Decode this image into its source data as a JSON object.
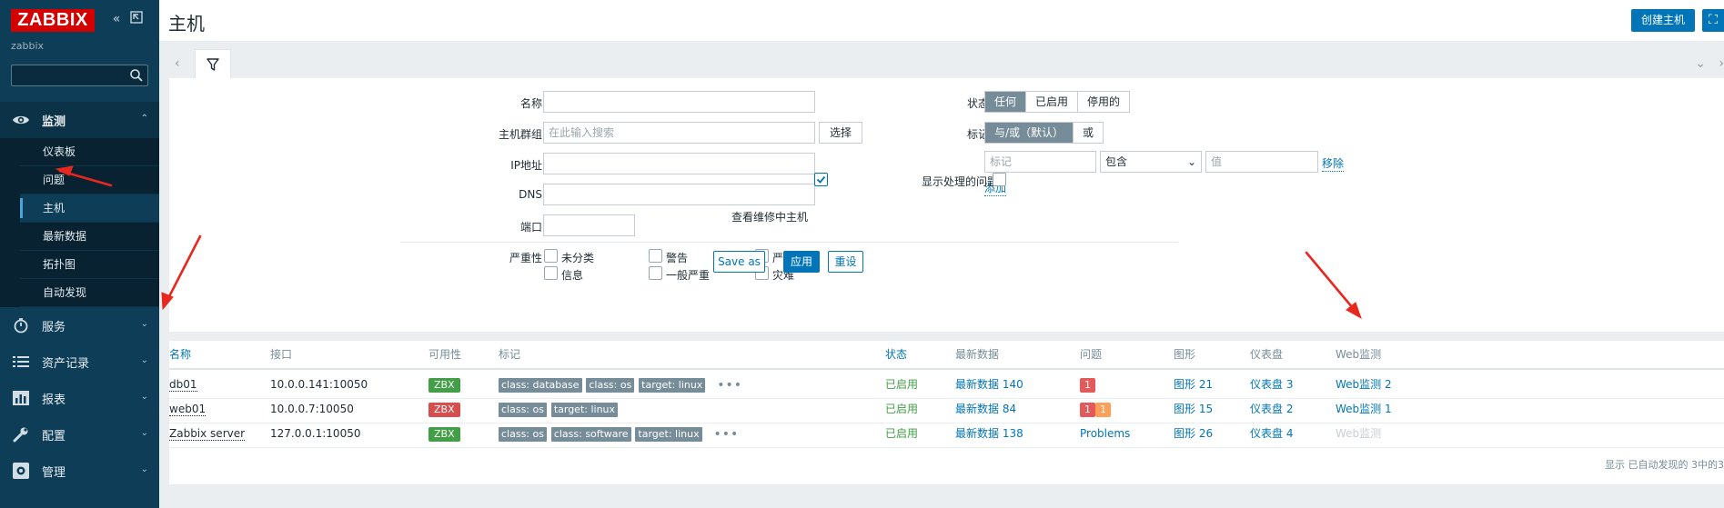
{
  "sidebar": {
    "logo": "ZABBIX",
    "server_name": "zabbix",
    "search_placeholder": "",
    "sections": [
      {
        "label": "监测",
        "icon": "eye-icon",
        "open": true
      },
      {
        "label": "服务",
        "icon": "clock-icon"
      },
      {
        "label": "资产记录",
        "icon": "list-icon"
      },
      {
        "label": "报表",
        "icon": "chart-icon"
      },
      {
        "label": "配置",
        "icon": "wrench-icon"
      },
      {
        "label": "管理",
        "icon": "gear-icon"
      }
    ],
    "monitoring_items": [
      "仪表板",
      "问题",
      "主机",
      "最新数据",
      "拓扑图",
      "自动发现"
    ],
    "selected_item": "主机"
  },
  "header": {
    "title": "主机",
    "create_button": "创建主机"
  },
  "filter": {
    "labels": {
      "name": "名称",
      "host_groups": "主机群组",
      "ip": "IP地址",
      "dns": "DNS",
      "port": "端口",
      "severity": "严重性",
      "status": "状态",
      "tags": "标记",
      "show_maintenance": "查看维修中主机",
      "show_suppressed": "显示处理的问题"
    },
    "host_groups_placeholder": "在此输入搜索",
    "select_button": "选择",
    "status_options": [
      "任何",
      "已启用",
      "停用的"
    ],
    "status_selected": "任何",
    "tag_eval_options": [
      "与/或（默认）",
      "或"
    ],
    "tag_eval_selected": "与/或（默认）",
    "tag_placeholder": "标记",
    "tag_operator": "包含",
    "tag_value_placeholder": "值",
    "remove_link": "移除",
    "add_link": "添加",
    "severities": [
      "未分类",
      "警告",
      "严重",
      "信息",
      "一般严重",
      "灾难"
    ],
    "show_maintenance_checked": true,
    "show_suppressed_checked": false,
    "save_as": "Save as",
    "apply": "应用",
    "reset": "重设"
  },
  "table": {
    "columns": [
      "名称",
      "接口",
      "可用性",
      "标记",
      "状态",
      "最新数据",
      "问题",
      "图形",
      "仪表盘",
      "Web监测"
    ],
    "rows": [
      {
        "name": "db01",
        "interface": "10.0.0.141:10050",
        "availability": "ZBX",
        "avail_ok": true,
        "tags": [
          "class: database",
          "class: os",
          "target: linux"
        ],
        "more": true,
        "status": "已启用",
        "latest": "最新数据 140",
        "problems": [
          "1"
        ],
        "graphs": "图形 21",
        "dashboards": "仪表盘 3",
        "web": "Web监测 2"
      },
      {
        "name": "web01",
        "interface": "10.0.0.7:10050",
        "availability": "ZBX",
        "avail_ok": false,
        "tags": [
          "class: os",
          "target: linux"
        ],
        "more": false,
        "status": "已启用",
        "latest": "最新数据 84",
        "problems": [
          "1",
          "1"
        ],
        "graphs": "图形 15",
        "dashboards": "仪表盘 2",
        "web": "Web监测 1"
      },
      {
        "name": "Zabbix server",
        "interface": "127.0.0.1:10050",
        "availability": "ZBX",
        "avail_ok": true,
        "tags": [
          "class: os",
          "class: software",
          "target: linux"
        ],
        "more": true,
        "status": "已启用",
        "latest": "最新数据 138",
        "problems_text": "Problems",
        "graphs": "图形 26",
        "dashboards": "仪表盘 4",
        "web": "Web监测"
      }
    ],
    "footer": "显示 已自动发现的 3中的3"
  },
  "colors": {
    "sidebar": "#0e3d57",
    "accent": "#0275b8",
    "logo": "#d40000",
    "enabled": "#429e47",
    "annotation_arrow": "#e8271f"
  }
}
